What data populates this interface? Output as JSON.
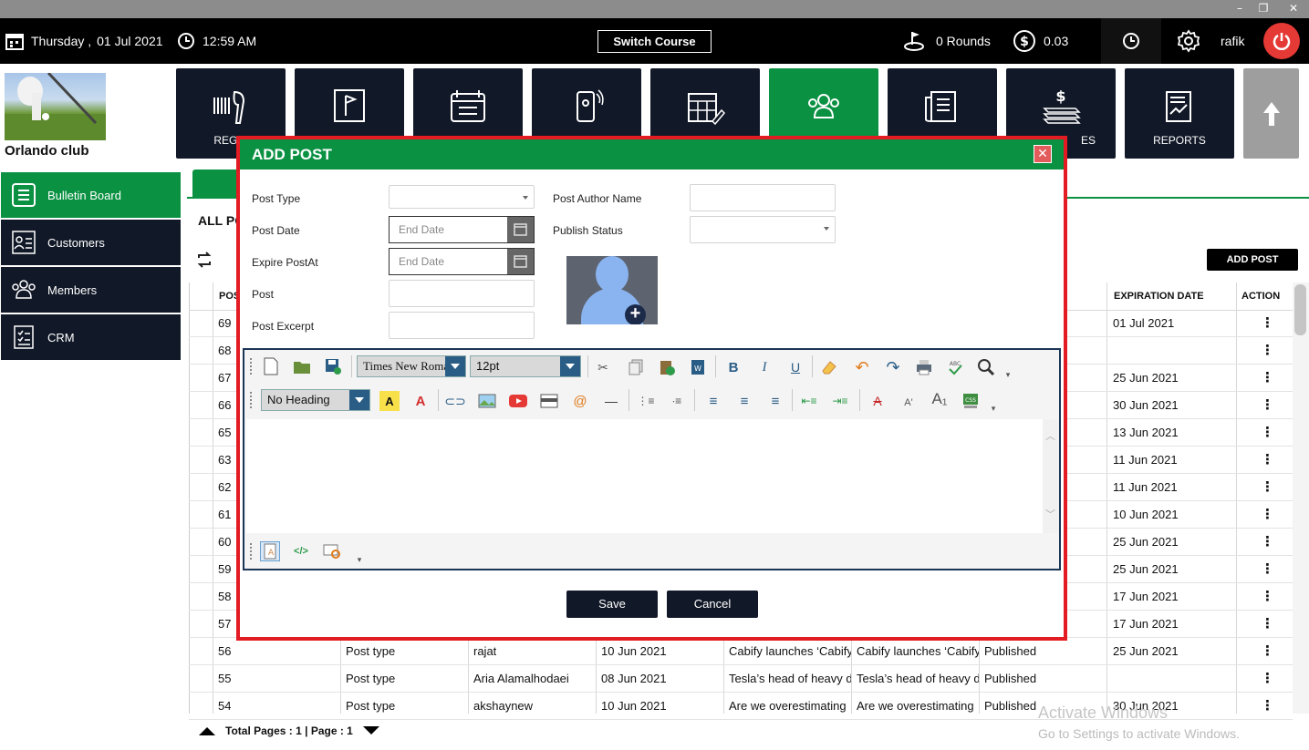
{
  "window": {
    "minimize": "–",
    "restore": "❐",
    "close": "✕"
  },
  "header": {
    "day": "Thursday ,",
    "date": "01 Jul 2021",
    "time": "12:59 AM",
    "switch_course": "Switch Course",
    "rounds": "0 Rounds",
    "balance": "0.03",
    "username": "rafik"
  },
  "club_name": "Orlando club",
  "nav_tiles": [
    {
      "label": "REGIS",
      "icon": "barcode-scanner-icon"
    },
    {
      "label": "",
      "icon": "flag-icon"
    },
    {
      "label": "",
      "icon": "calendar-list-icon"
    },
    {
      "label": "",
      "icon": "mobile-icon"
    },
    {
      "label": "",
      "icon": "calendar-edit-icon"
    },
    {
      "label": "",
      "icon": "users-icon"
    },
    {
      "label": "",
      "icon": "document-icon"
    },
    {
      "label": "ES",
      "icon": "money-icon"
    },
    {
      "label": "REPORTS",
      "icon": "report-icon"
    }
  ],
  "sidebar": {
    "items": [
      {
        "label": "Bulletin Board",
        "active": true
      },
      {
        "label": "Customers"
      },
      {
        "label": "Members"
      },
      {
        "label": "CRM"
      }
    ]
  },
  "main": {
    "title": "ALL PO",
    "add_post_label": "ADD POST",
    "columns": {
      "post": "POS",
      "expiration": "EXPIRATION DATE",
      "action": "ACTION"
    },
    "rows": [
      {
        "id": "69",
        "type": "",
        "author": "",
        "date": "",
        "title": "",
        "excerpt": "",
        "status": "",
        "exp": "01 Jul 2021"
      },
      {
        "id": "68",
        "type": "",
        "author": "",
        "date": "",
        "title": "",
        "excerpt": "",
        "status": "",
        "exp": ""
      },
      {
        "id": "67",
        "type": "",
        "author": "",
        "date": "",
        "title": "",
        "excerpt": "",
        "status": "",
        "exp": "25 Jun 2021"
      },
      {
        "id": "66",
        "type": "",
        "author": "",
        "date": "",
        "title": "",
        "excerpt": "",
        "status": "",
        "exp": "30 Jun 2021"
      },
      {
        "id": "65",
        "type": "",
        "author": "",
        "date": "",
        "title": "",
        "excerpt": "",
        "status": "",
        "exp": "13 Jun 2021"
      },
      {
        "id": "63",
        "type": "",
        "author": "",
        "date": "",
        "title": "",
        "excerpt": "",
        "status": "",
        "exp": "11 Jun 2021"
      },
      {
        "id": "62",
        "type": "",
        "author": "",
        "date": "",
        "title": "",
        "excerpt": "",
        "status": "",
        "exp": "11 Jun 2021"
      },
      {
        "id": "61",
        "type": "",
        "author": "",
        "date": "",
        "title": "",
        "excerpt": "",
        "status": "",
        "exp": "10 Jun 2021"
      },
      {
        "id": "60",
        "type": "",
        "author": "",
        "date": "",
        "title": "",
        "excerpt": "",
        "status": "",
        "exp": "25 Jun 2021"
      },
      {
        "id": "59",
        "type": "",
        "author": "",
        "date": "",
        "title": "",
        "excerpt": "",
        "status": "",
        "exp": "25 Jun 2021"
      },
      {
        "id": "58",
        "type": "",
        "author": "",
        "date": "",
        "title": "",
        "excerpt": "",
        "status": "",
        "exp": "17 Jun 2021"
      },
      {
        "id": "57",
        "type": "",
        "author": "",
        "date": "",
        "title": "",
        "excerpt": "",
        "status": "",
        "exp": "17 Jun 2021"
      },
      {
        "id": "56",
        "type": "Post type",
        "author": "rajat",
        "date": "10 Jun 2021",
        "title": "Cabify launches ‘Cabify",
        "excerpt": "Cabify launches ‘Cabify",
        "status": "Published",
        "exp": "25 Jun 2021"
      },
      {
        "id": "55",
        "type": "Post type",
        "author": "Aria Alamalhodaei",
        "date": "08 Jun 2021",
        "title": "Tesla’s head of heavy d",
        "excerpt": "Tesla’s head of heavy d",
        "status": "Published",
        "exp": ""
      },
      {
        "id": "54",
        "type": "Post type",
        "author": "akshaynew",
        "date": "10 Jun 2021",
        "title": "Are we overestimating",
        "excerpt": "Are we overestimating",
        "status": "Published",
        "exp": "30 Jun 2021"
      }
    ],
    "action_glyph": "⋮",
    "pager": "Total Pages : 1 | Page : 1"
  },
  "watermark": {
    "line1": "Activate Windows",
    "line2": "Go to Settings to activate Windows."
  },
  "modal": {
    "title": "ADD POST",
    "close": "✕",
    "labels": {
      "post_type": "Post Type",
      "post_date": "Post Date",
      "expire": "Expire PostAt",
      "post": "Post",
      "excerpt": "Post Excerpt",
      "author": "Post Author Name",
      "publish_status": "Publish Status"
    },
    "post_date_placeholder": "End Date",
    "expire_placeholder": "End Date",
    "font_family": "Times New Roman",
    "font_size": "12pt",
    "heading": "No Heading",
    "save": "Save",
    "cancel": "Cancel"
  },
  "colors": {
    "accent_green": "#0a9142",
    "modal_border": "#e31b23",
    "dark_tile": "#111827"
  }
}
